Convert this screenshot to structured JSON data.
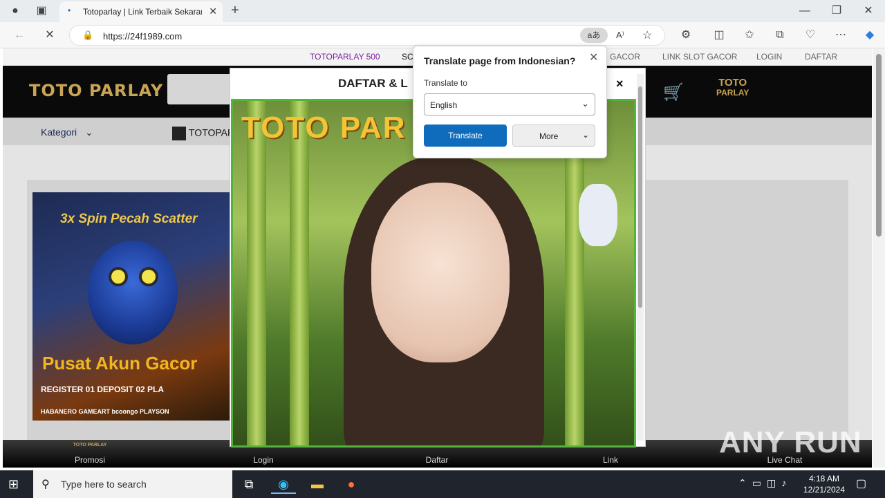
{
  "browser": {
    "tab_title": "Totoparlay | Link Terbaik Sekarang",
    "url": "https://24f1989.com",
    "read_aloud_icon": "A⁾",
    "translate_icon": "aあ"
  },
  "site": {
    "topnav": [
      "TOTOPARLAY 500",
      "SC",
      "GACOR",
      "LINK SLOT GACOR",
      "LOGIN",
      "DAFTAR"
    ],
    "logo": "TOTO PARLAY",
    "small_logo": [
      "TOTO",
      "PARLAY"
    ],
    "kategori": "Kategori",
    "category_link": "TOTOPAR",
    "banner": {
      "top_text": "3x Spin Pecah Scatter",
      "headline": "Pusat Akun Gacor",
      "steps": "REGISTER 01   DEPOSIT 02   PLA",
      "providers_bottom": "HABANERO  GAMEART  bcoongo  PLAYSON"
    },
    "bottom_nav": [
      "Promosi",
      "Login",
      "Daftar",
      "Link",
      "Live Chat"
    ],
    "bottom_nav_mini": "TOTO PARLAY",
    "watermark": "ANY RUN"
  },
  "modal": {
    "title": "DAFTAR & L",
    "close": "×",
    "image_brand": "TOTO PAR"
  },
  "translate": {
    "title": "Translate page from Indonesian?",
    "label": "Translate to",
    "selected_language": "English",
    "translate_button": "Translate",
    "more_button": "More"
  },
  "taskbar": {
    "search_placeholder": "Type here to search",
    "time": "4:18 AM",
    "date": "12/21/2024"
  },
  "colors": {
    "translate_button": "#0f6cbd",
    "topnav_highlight": "#7b1fa2",
    "logo_gold": "#c9a456",
    "modal_border": "#53b33a"
  }
}
